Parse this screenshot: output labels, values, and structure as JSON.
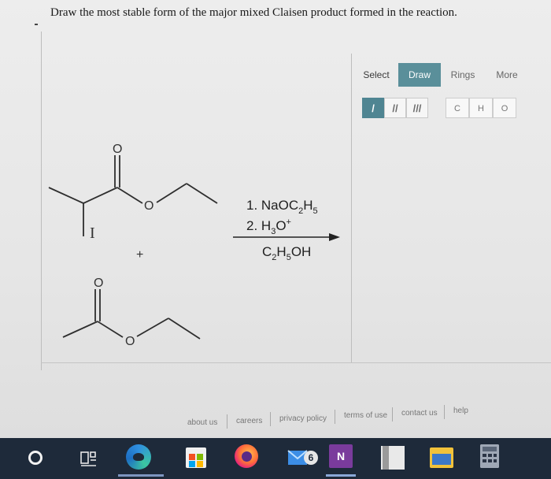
{
  "question": {
    "text": "Draw the most stable form of the major mixed Claisen product formed in the reaction."
  },
  "reaction": {
    "reactant1": {
      "carbonyl_o": "O",
      "ester_o": "O"
    },
    "reactant2": {
      "carbonyl_o": "O",
      "ester_o": "O"
    },
    "plus": "+",
    "cursor_glyph": "I",
    "reagents": {
      "line1_prefix": "1. NaOC",
      "line1_sub1": "2",
      "line1_mid": "H",
      "line1_sub2": "5",
      "line2_prefix": "2. H",
      "line2_sub": "3",
      "line2_mid": "O",
      "line2_sup": "+",
      "solvent_prefix": "C",
      "solvent_sub1": "2",
      "solvent_mid": "H",
      "solvent_sub2": "5",
      "solvent_suffix": "OH"
    }
  },
  "toolbar": {
    "tabs": [
      "Select",
      "Draw",
      "Rings",
      "More"
    ],
    "active_tab": "Draw",
    "active_color": "#5a8f9a",
    "bond_buttons": [
      "/",
      "//",
      "///"
    ],
    "atom_buttons": [
      "C",
      "H",
      "O"
    ]
  },
  "footer": {
    "links": [
      "about us",
      "careers",
      "privacy policy",
      "terms of use",
      "contact us",
      "help"
    ]
  },
  "taskbar": {
    "icons": [
      "start-icon",
      "task-view-icon",
      "edge-icon",
      "store-icon",
      "firefox-icon",
      "mail-icon",
      "onenote-icon",
      "files-icon",
      "folder-icon",
      "calculator-icon"
    ],
    "mail_badge": "6",
    "onenote_letter": "N"
  }
}
